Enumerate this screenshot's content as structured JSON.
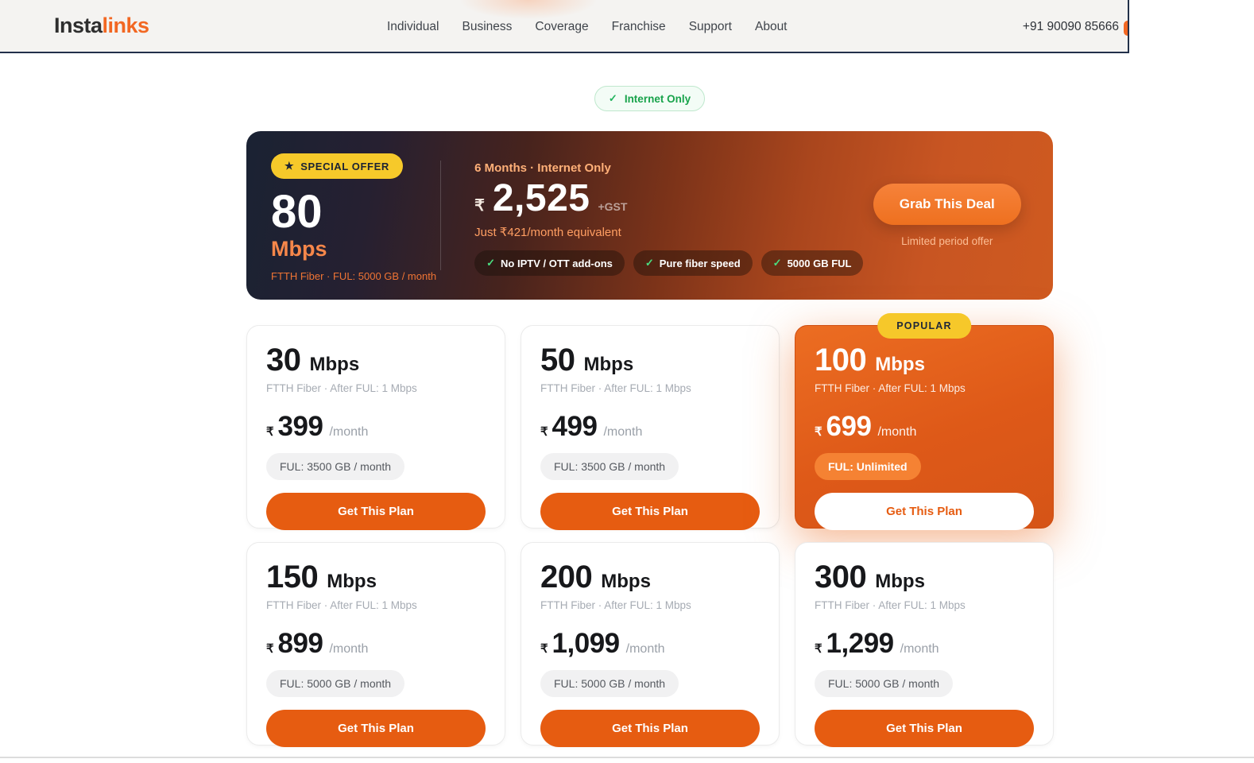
{
  "header": {
    "logo_part1": "Insta",
    "logo_part2": "links",
    "nav": [
      "Individual",
      "Business",
      "Coverage",
      "Franchise",
      "Support",
      "About"
    ],
    "phone": "+91 90090 85666"
  },
  "icons": {
    "check": "✓",
    "star": "★"
  },
  "filter": {
    "label": "Internet Only"
  },
  "offer": {
    "badge_label": "SPECIAL OFFER",
    "speed": "80",
    "speed_unit": "Mbps",
    "meta": "FTTH Fiber · FUL: 5000 GB / month",
    "duration": "6 Months · Internet Only",
    "currency": "₹",
    "price": "2,525",
    "price_suffix": "+GST",
    "equivalent": "Just ₹421/month equivalent",
    "features": [
      "No IPTV / OTT add-ons",
      "Pure fiber speed",
      "5000 GB FUL"
    ],
    "cta_label": "Grab This Deal",
    "cta_note": "Limited period offer"
  },
  "popular_badge": "POPULAR",
  "plans": [
    {
      "speed": "30",
      "unit": "Mbps",
      "meta": "FTTH Fiber · After FUL: 1 Mbps",
      "currency": "₹",
      "price": "399",
      "period": "/month",
      "ful": "FUL: 3500 GB / month",
      "cta": "Get This Plan"
    },
    {
      "speed": "50",
      "unit": "Mbps",
      "meta": "FTTH Fiber · After FUL: 1 Mbps",
      "currency": "₹",
      "price": "499",
      "period": "/month",
      "ful": "FUL: 3500 GB / month",
      "cta": "Get This Plan"
    },
    {
      "speed": "100",
      "unit": "Mbps",
      "meta": "FTTH Fiber · After FUL: 1 Mbps",
      "currency": "₹",
      "price": "699",
      "period": "/month",
      "ful": "FUL: Unlimited",
      "cta": "Get This Plan"
    },
    {
      "speed": "150",
      "unit": "Mbps",
      "meta": "FTTH Fiber · After FUL: 1 Mbps",
      "currency": "₹",
      "price": "899",
      "period": "/month",
      "ful": "FUL: 5000 GB / month",
      "cta": "Get This Plan"
    },
    {
      "speed": "200",
      "unit": "Mbps",
      "meta": "FTTH Fiber · After FUL: 1 Mbps",
      "currency": "₹",
      "price": "1,099",
      "period": "/month",
      "ful": "FUL: 5000 GB / month",
      "cta": "Get This Plan"
    },
    {
      "speed": "300",
      "unit": "Mbps",
      "meta": "FTTH Fiber · After FUL: 1 Mbps",
      "currency": "₹",
      "price": "1,299",
      "period": "/month",
      "ful": "FUL: 5000 GB / month",
      "cta": "Get This Plan"
    }
  ],
  "colors": {
    "accent_orange": "#e65c11",
    "logo_orange": "#f26722",
    "badge_yellow": "#f6c92a",
    "success_green": "#16a34a",
    "banner_dark": "#1a2233",
    "banner_orange": "#cf5a20"
  }
}
